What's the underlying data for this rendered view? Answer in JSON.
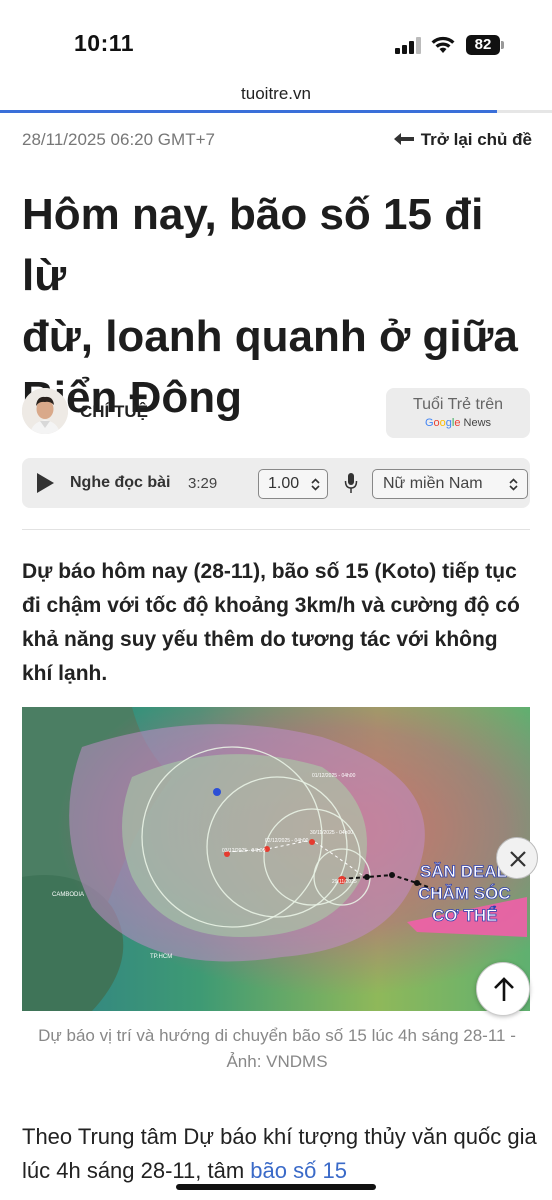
{
  "status_bar": {
    "time": "10:11",
    "battery": "82",
    "icons": [
      "cellular-signal-icon",
      "wifi-icon",
      "battery-icon"
    ]
  },
  "browser": {
    "url": "tuoitre.vn",
    "scroll_progress_percent": 90
  },
  "article": {
    "date": "28/11/2025 06:20 GMT+7",
    "back_link": "Trở lại chủ đề",
    "headline_lines": [
      "Hôm nay, bão số 15 đi lừ",
      "đừ, loanh quanh ở giữa",
      "Biển Đông"
    ],
    "author": "CHÍ TUỆ",
    "google_news": {
      "line1": "Tuổi Trẻ trên",
      "google": "Google",
      "news": "News"
    },
    "player": {
      "label": "Nghe đọc bài",
      "duration": "3:29",
      "speed": "1.00",
      "voice": "Nữ miền Nam"
    },
    "lead": "Dự báo hôm nay (28-11), bão số 15 (Koto) tiếp tục đi chậm với tốc độ khoảng 3km/h và cường độ có khả năng suy yếu thêm do tương tác với không khí lạnh.",
    "image": {
      "map_labels": [
        "CAMBODIA",
        "TP.HCM"
      ],
      "forecast_labels": [
        "03/12/2025 - 04h00",
        "02/12/2025 - 04h00",
        "01/12/2025 - 04h00",
        "30/11/2025 - 04h00",
        "29/11/2025"
      ],
      "ad_text": [
        "SĂN DEAL",
        "CHĂM SÓC",
        "CƠ THỂ"
      ],
      "caption": "Dự báo vị trí và hướng di chuyển bão số 15 lúc 4h sáng 28-11 - Ảnh: VNDMS"
    },
    "body_start": "Theo Trung tâm Dự báo khí tượng thủy văn quốc gia lúc 4h sáng 28-11, tâm",
    "body_link": "bão số 15"
  },
  "colors": {
    "link": "#3a6ac8",
    "progress": "#3a6fd9",
    "text": "#222222"
  }
}
